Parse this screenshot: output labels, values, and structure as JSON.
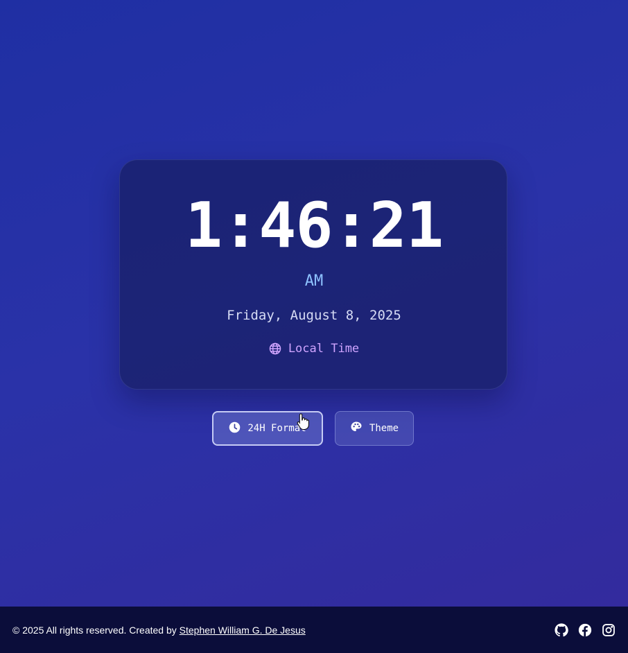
{
  "clock": {
    "time": "1:46:21",
    "period": "AM",
    "date": "Friday, August 8, 2025",
    "timezone_label": "Local Time",
    "timezone_icon": "globe-icon"
  },
  "controls": {
    "format_button": {
      "label": "24H Format",
      "icon": "clock-icon"
    },
    "theme_button": {
      "label": "Theme",
      "icon": "palette-icon"
    }
  },
  "footer": {
    "copyright": "© 2025 All rights reserved. Created by ",
    "author": "Stephen William G. De Jesus",
    "socials": [
      "github-icon",
      "facebook-icon",
      "instagram-icon"
    ]
  },
  "colors": {
    "accent_ampm": "#8ec2ff",
    "accent_timezone": "#cfa4ff",
    "footer_bg": "#0b0d3a"
  }
}
